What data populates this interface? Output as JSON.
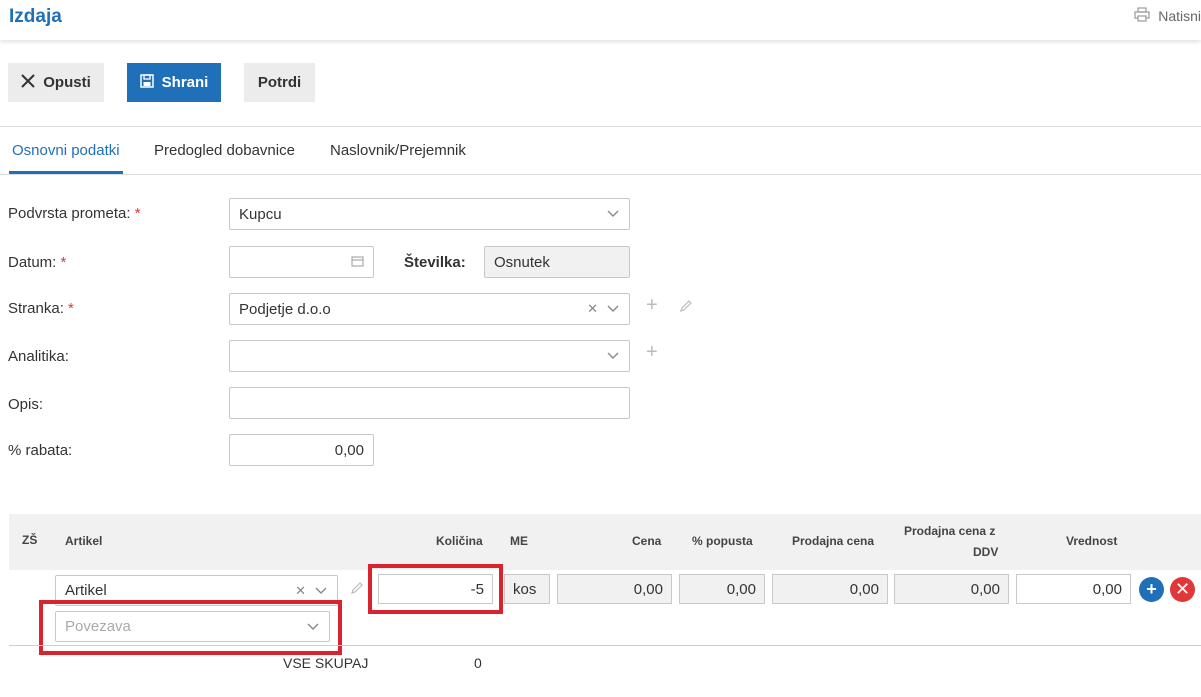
{
  "header": {
    "title": "Izdaja",
    "print_label": "Natisni"
  },
  "toolbar": {
    "cancel_label": "Opusti",
    "save_label": "Shrani",
    "confirm_label": "Potrdi"
  },
  "tabs": [
    {
      "label": "Osnovni podatki",
      "active": true
    },
    {
      "label": "Predogled dobavnice",
      "active": false
    },
    {
      "label": "Naslovnik/Prejemnik",
      "active": false
    }
  ],
  "form": {
    "subtype": {
      "label": "Podvrsta prometa:",
      "value": "Kupcu"
    },
    "date": {
      "label": "Datum:",
      "value": ""
    },
    "number": {
      "label": "Številka:",
      "value": "Osnutek"
    },
    "customer": {
      "label": "Stranka:",
      "value": "Podjetje d.o.o"
    },
    "analytics": {
      "label": "Analitika:",
      "value": ""
    },
    "description": {
      "label": "Opis:",
      "value": ""
    },
    "discount": {
      "label": "% rabata:",
      "value": "0,00"
    },
    "required_mark": "*"
  },
  "table": {
    "headers": {
      "zs": "ZŠ",
      "article": "Artikel",
      "quantity": "Količina",
      "unit": "ME",
      "price": "Cena",
      "discount_pct": "% popusta",
      "sale_price": "Prodajna cena",
      "sale_price_vat_line1": "Prodajna cena z",
      "sale_price_vat_line2": "DDV",
      "value": "Vrednost"
    },
    "row": {
      "article": "Artikel",
      "link_placeholder": "Povezava",
      "quantity": "-5",
      "unit": "kos",
      "price": "0,00",
      "discount_pct": "0,00",
      "sale_price": "0,00",
      "sale_price_vat": "0,00",
      "value": "0,00"
    },
    "total_label": "VSE SKUPAJ",
    "total_quantity": "0"
  },
  "colors": {
    "accent": "#1f70b8",
    "danger": "#e0383a",
    "highlight": "#d9232e"
  }
}
